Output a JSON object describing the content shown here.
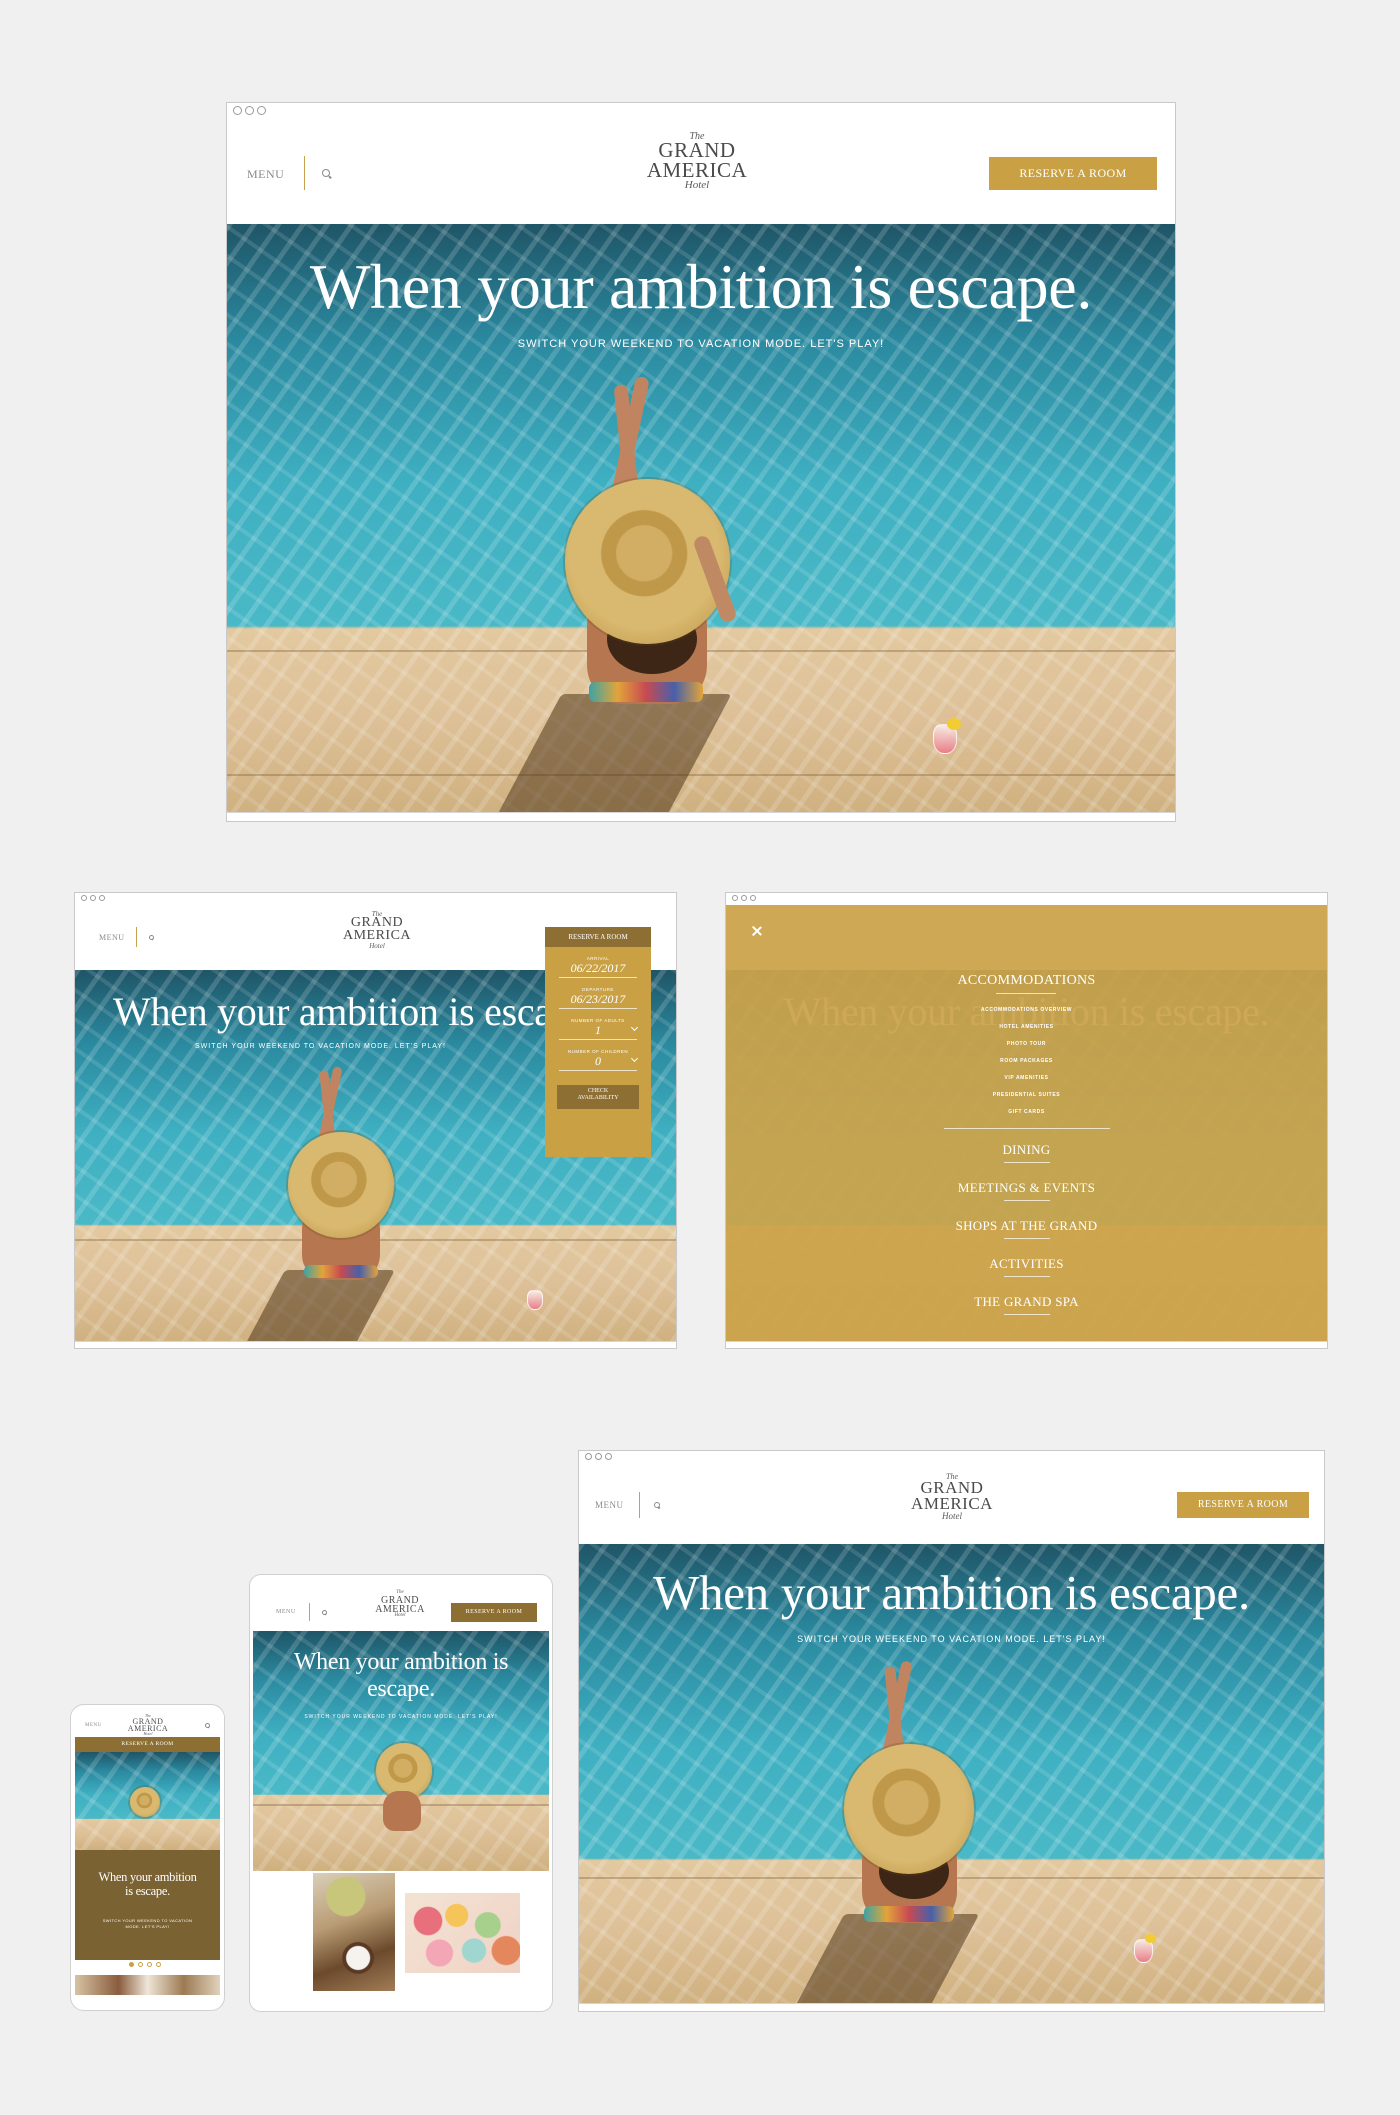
{
  "brand": {
    "the": "The",
    "name_line1": "GRAND",
    "name_line2": "AMERICA",
    "hotel": "Hotel"
  },
  "header": {
    "menu_label": "MENU",
    "reserve_label": "RESERVE A ROOM"
  },
  "hero": {
    "title": "When your ambition is escape.",
    "subtitle": "SWITCH YOUR WEEKEND TO VACATION MODE. LET'S PLAY!",
    "title_tablet_line1": "When your ambition is",
    "title_tablet_line2": "escape.",
    "title_mobile_line1": "When your ambition",
    "title_mobile_line2": "is escape.",
    "subtitle_mobile_line1": "SWITCH YOUR WEEKEND TO VACATION",
    "subtitle_mobile_line2": "MODE. LET'S PLAY!"
  },
  "booking": {
    "title": "RESERVE A ROOM",
    "arrival_label": "ARRIVAL",
    "arrival_value": "06/22/2017",
    "departure_label": "DEPARTURE",
    "departure_value": "06/23/2017",
    "adults_label": "NUMBER OF ADULTS",
    "adults_value": "1",
    "children_label": "NUMBER OF CHILDREN",
    "children_value": "0",
    "check_line1": "CHECK",
    "check_line2": "AVAILABILITY"
  },
  "nav": {
    "accommodations": "ACCOMMODATIONS",
    "sub_items": [
      "ACCOMMODATIONS OVERVIEW",
      "HOTEL AMENITIES",
      "PHOTO TOUR",
      "ROOM PACKAGES",
      "VIP AMENITIES",
      "PRESIDENTIAL SUITES",
      "GIFT CARDS"
    ],
    "items": [
      "DINING",
      "MEETINGS & EVENTS",
      "SHOPS AT THE GRAND",
      "ACTIVITIES",
      "THE GRAND SPA"
    ]
  },
  "colors": {
    "gold": "#c9a144",
    "dark_gold": "#8d6f33",
    "olive": "#7a6232",
    "background": "#f0f0f0"
  },
  "icons": [
    "search-icon",
    "close-icon",
    "chevron-down-icon"
  ]
}
